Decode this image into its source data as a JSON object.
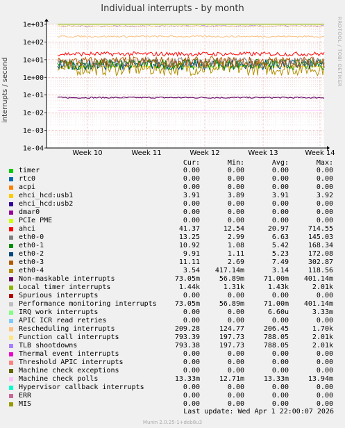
{
  "title": "Individual interrupts - by month",
  "side_label": "RRDTOOL / TOBI OETIKER",
  "footer": "Munin 2.0.25-1+deb8u3",
  "last_update": "Last update:  Wed Apr  1 22:00:07 2026",
  "legend_headers": {
    "cur": "Cur:",
    "min": "Min:",
    "avg": "Avg:",
    "max": "Max:"
  },
  "legend": [
    {
      "label": "timer",
      "color": "#00cc00",
      "cur": "0.00",
      "min": "0.00",
      "avg": "0.00",
      "max": "0.00"
    },
    {
      "label": "rtc0",
      "color": "#0066b3",
      "cur": "0.00",
      "min": "0.00",
      "avg": "0.00",
      "max": "0.00"
    },
    {
      "label": "acpi",
      "color": "#ff8000",
      "cur": "0.00",
      "min": "0.00",
      "avg": "0.00",
      "max": "0.00"
    },
    {
      "label": "ehci_hcd:usb1",
      "color": "#ffcc00",
      "cur": "3.91",
      "min": "3.89",
      "avg": "3.91",
      "max": "3.92"
    },
    {
      "label": "ehci_hcd:usb2",
      "color": "#330099",
      "cur": "0.00",
      "min": "0.00",
      "avg": "0.00",
      "max": "0.00"
    },
    {
      "label": "dmar0",
      "color": "#990099",
      "cur": "0.00",
      "min": "0.00",
      "avg": "0.00",
      "max": "0.00"
    },
    {
      "label": "PCIe PME",
      "color": "#ccff00",
      "cur": "0.00",
      "min": "0.00",
      "avg": "0.00",
      "max": "0.00"
    },
    {
      "label": "ahci",
      "color": "#ff0000",
      "cur": "41.37",
      "min": "12.54",
      "avg": "20.97",
      "max": "714.55"
    },
    {
      "label": "eth0-0",
      "color": "#808080",
      "cur": "13.25",
      "min": "2.99",
      "avg": "6.63",
      "max": "145.03"
    },
    {
      "label": "eth0-1",
      "color": "#008f00",
      "cur": "10.92",
      "min": "1.08",
      "avg": "5.42",
      "max": "168.34"
    },
    {
      "label": "eth0-2",
      "color": "#00487d",
      "cur": "9.91",
      "min": "1.11",
      "avg": "5.23",
      "max": "172.08"
    },
    {
      "label": "eth0-3",
      "color": "#b35a00",
      "cur": "11.11",
      "min": "2.69",
      "avg": "7.49",
      "max": "302.87"
    },
    {
      "label": "eth0-4",
      "color": "#b38f00",
      "cur": "3.54",
      "min": "417.14m",
      "avg": "3.14",
      "max": "118.56"
    },
    {
      "label": "Non-maskable interrupts",
      "color": "#6b006b",
      "cur": "73.05m",
      "min": "56.89m",
      "avg": "71.00m",
      "max": "401.14m"
    },
    {
      "label": "Local timer interrupts",
      "color": "#8fb300",
      "cur": "1.44k",
      "min": "1.31k",
      "avg": "1.43k",
      "max": "2.01k"
    },
    {
      "label": "Spurious interrupts",
      "color": "#b30000",
      "cur": "0.00",
      "min": "0.00",
      "avg": "0.00",
      "max": "0.00"
    },
    {
      "label": "Performance monitoring interrupts",
      "color": "#bebebe",
      "cur": "73.05m",
      "min": "56.89m",
      "avg": "71.00m",
      "max": "401.14m"
    },
    {
      "label": "IRQ work interrupts",
      "color": "#80ff80",
      "cur": "0.00",
      "min": "0.00",
      "avg": "6.60u",
      "max": "3.33m"
    },
    {
      "label": "APIC ICR read retries",
      "color": "#80c9ff",
      "cur": "0.00",
      "min": "0.00",
      "avg": "0.00",
      "max": "0.00"
    },
    {
      "label": "Rescheduling interrupts",
      "color": "#ffc080",
      "cur": "209.28",
      "min": "124.77",
      "avg": "206.45",
      "max": "1.70k"
    },
    {
      "label": "Function call interrupts",
      "color": "#ffe680",
      "cur": "793.39",
      "min": "197.73",
      "avg": "788.05",
      "max": "2.01k"
    },
    {
      "label": "TLB shootdowns",
      "color": "#aa80ff",
      "cur": "793.38",
      "min": "197.73",
      "avg": "788.05",
      "max": "2.01k"
    },
    {
      "label": "Thermal event interrupts",
      "color": "#ee00cc",
      "cur": "0.00",
      "min": "0.00",
      "avg": "0.00",
      "max": "0.00"
    },
    {
      "label": "Threshold APIC interrupts",
      "color": "#ff8080",
      "cur": "0.00",
      "min": "0.00",
      "avg": "0.00",
      "max": "0.00"
    },
    {
      "label": "Machine check exceptions",
      "color": "#666600",
      "cur": "0.00",
      "min": "0.00",
      "avg": "0.00",
      "max": "0.00"
    },
    {
      "label": "Machine check polls",
      "color": "#ffbfff",
      "cur": "13.33m",
      "min": "12.71m",
      "avg": "13.33m",
      "max": "13.94m"
    },
    {
      "label": "Hypervisor callback interrupts",
      "color": "#00ffcc",
      "cur": "0.00",
      "min": "0.00",
      "avg": "0.00",
      "max": "0.00"
    },
    {
      "label": "ERR",
      "color": "#cc6699",
      "cur": "0.00",
      "min": "0.00",
      "avg": "0.00",
      "max": "0.00"
    },
    {
      "label": "MIS",
      "color": "#999900",
      "cur": "0.00",
      "min": "0.00",
      "avg": "0.00",
      "max": "0.00"
    }
  ],
  "chart_data": {
    "type": "line",
    "title": "Individual interrupts - by month",
    "ylabel": "interrupts / second",
    "yscale": "log",
    "ylim": [
      0.0001,
      1000
    ],
    "ytick_labels": [
      "1e+03",
      "1e+02",
      "1e+01",
      "1e+00",
      "1e-01",
      "1e-02",
      "1e-03",
      "1e-04"
    ],
    "xtick_labels": [
      "Week 10",
      "Week 11",
      "Week 12",
      "Week 13",
      "Week 14"
    ],
    "grid": true,
    "series": [
      {
        "name": "Local timer interrupts",
        "color": "#8fb300",
        "base": 1430,
        "jitter": 0.03
      },
      {
        "name": "Function call interrupts",
        "color": "#ffe680",
        "base": 788,
        "jitter": 0.04
      },
      {
        "name": "TLB shootdowns",
        "color": "#aa80ff",
        "base": 788,
        "jitter": 0.04
      },
      {
        "name": "Rescheduling interrupts",
        "color": "#ffc080",
        "base": 206,
        "jitter": 0.05
      },
      {
        "name": "ahci",
        "color": "#ff0000",
        "base": 20.97,
        "jitter": 0.12
      },
      {
        "name": "eth0-3",
        "color": "#b35a00",
        "base": 7.49,
        "jitter": 0.3
      },
      {
        "name": "eth0-0",
        "color": "#808080",
        "base": 6.63,
        "jitter": 0.3
      },
      {
        "name": "eth0-1",
        "color": "#008f00",
        "base": 5.42,
        "jitter": 0.3
      },
      {
        "name": "eth0-2",
        "color": "#00487d",
        "base": 5.23,
        "jitter": 0.3
      },
      {
        "name": "ehci_hcd:usb1",
        "color": "#ffcc00",
        "base": 3.91,
        "jitter": 0.02
      },
      {
        "name": "eth0-4",
        "color": "#b38f00",
        "base": 3.14,
        "jitter": 0.4
      },
      {
        "name": "Non-maskable interrupts",
        "color": "#6b006b",
        "base": 0.071,
        "jitter": 0.04
      },
      {
        "name": "Performance monitoring interrupts",
        "color": "#bebebe",
        "base": 0.071,
        "jitter": 0.04
      },
      {
        "name": "Machine check polls",
        "color": "#ffbfff",
        "base": 0.01333,
        "jitter": 0.02
      }
    ]
  }
}
